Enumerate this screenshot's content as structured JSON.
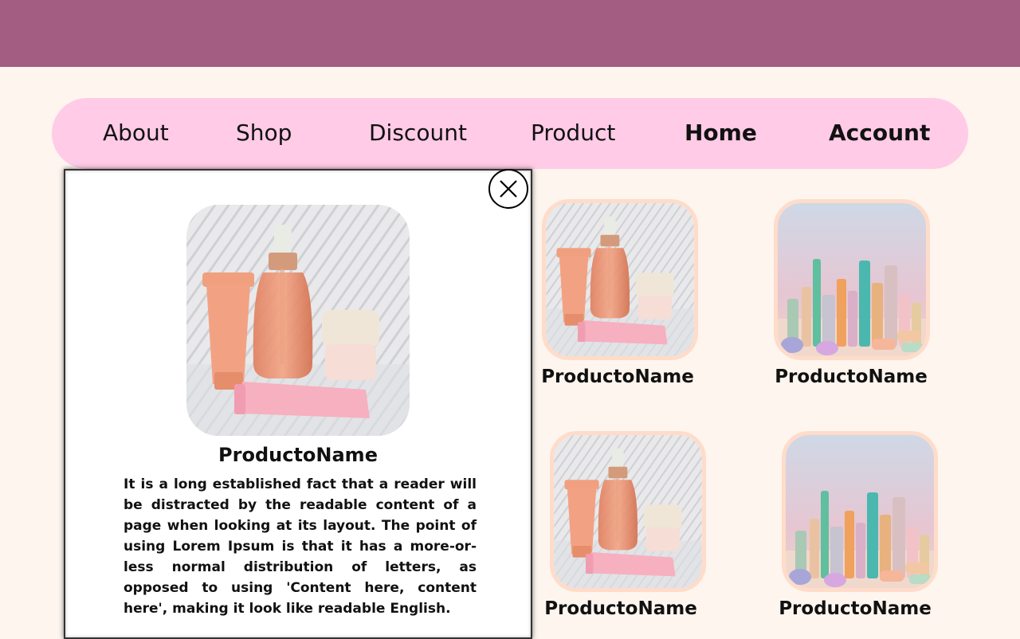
{
  "nav": {
    "items": [
      {
        "label": "About"
      },
      {
        "label": "Shop"
      },
      {
        "label": "Discount"
      },
      {
        "label": "Product"
      },
      {
        "label": "Home"
      },
      {
        "label": "Account"
      }
    ]
  },
  "modal": {
    "product_name": "ProductoName",
    "description": "It is a long established fact that a reader will be distracted by the readable content of a page when looking at its layout. The point of using Lorem Ipsum is that it has a more-or-less normal distribution of letters, as opposed to using 'Content here, content here', making it look like readable English."
  },
  "products": [
    {
      "name": "ProductoName",
      "image": "skincare-set"
    },
    {
      "name": "ProductoName",
      "image": "cosmetics-collection"
    },
    {
      "name": "ProductoName",
      "image": "skincare-set"
    },
    {
      "name": "ProductoName",
      "image": "cosmetics-collection"
    }
  ],
  "colors": {
    "header": "#a35c82",
    "nav_background": "#ffcbe6",
    "page_background": "#fdf5ee",
    "card_border": "#ffdcc9"
  }
}
